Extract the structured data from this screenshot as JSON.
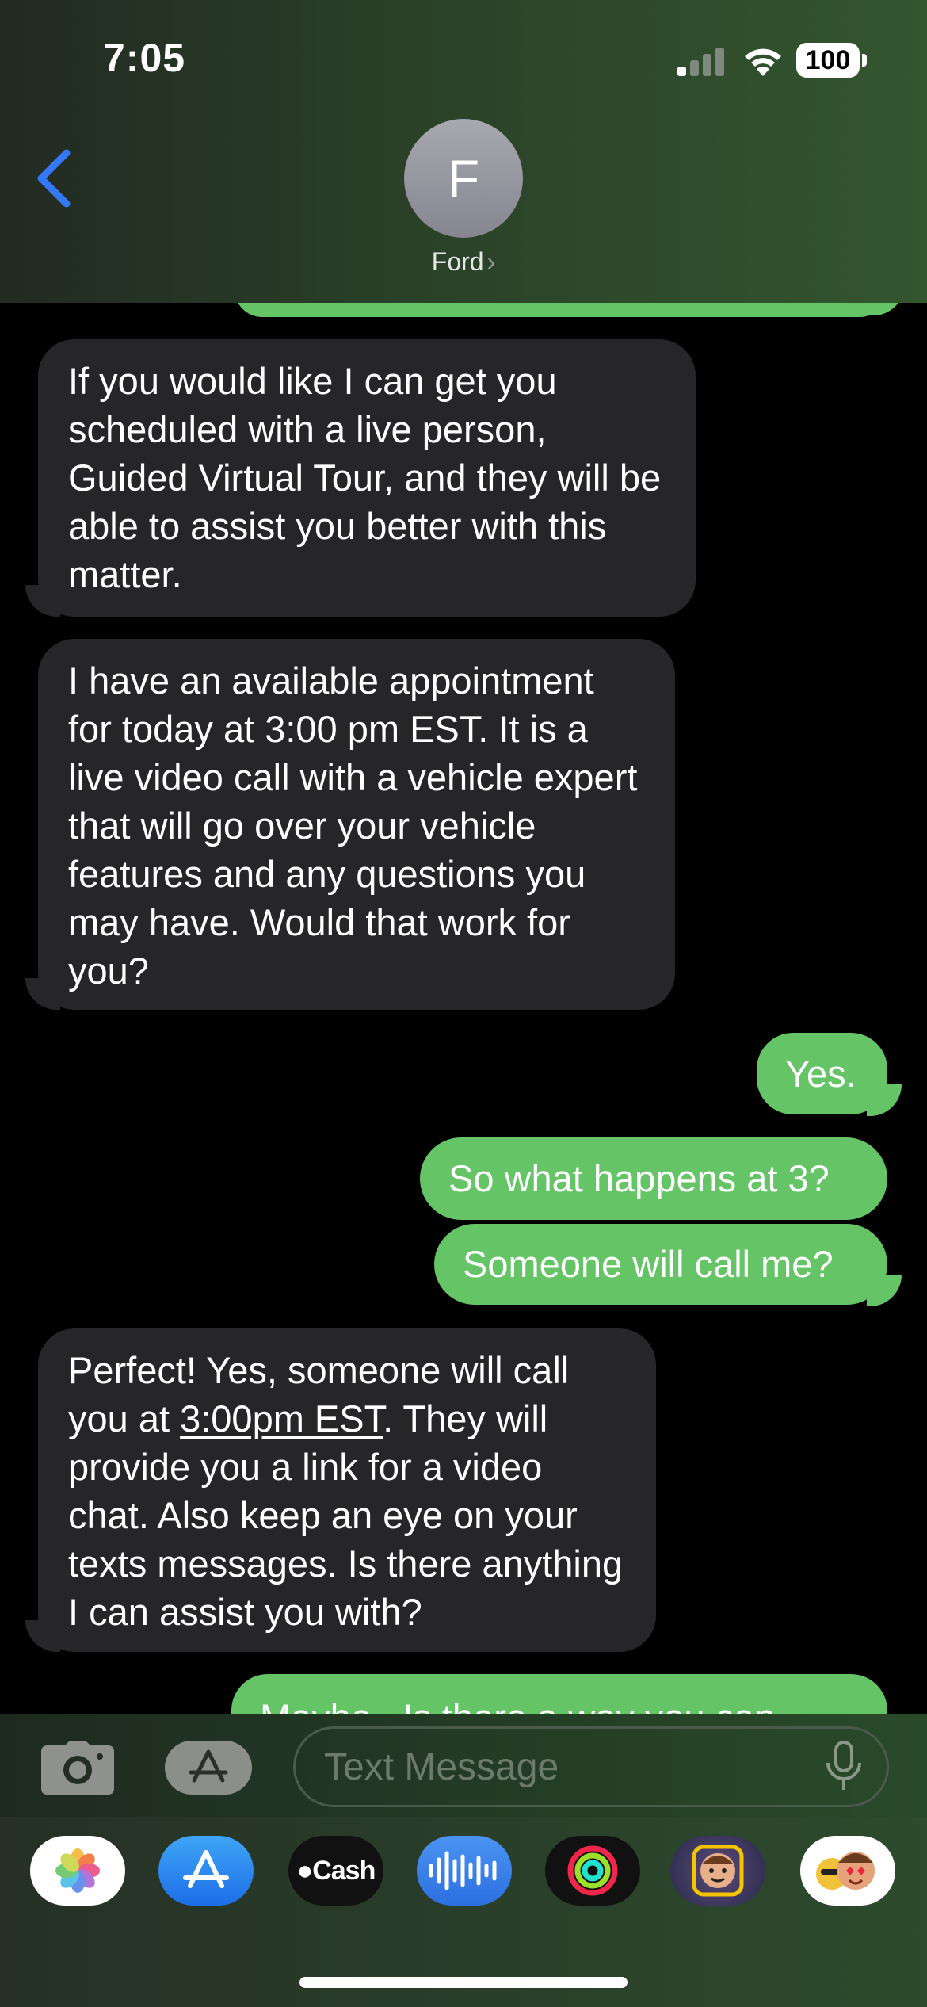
{
  "status_bar": {
    "time": "7:05",
    "battery": "100"
  },
  "header": {
    "avatar_letter": "F",
    "contact_name": "Ford",
    "chevron": "›"
  },
  "messages": [
    {
      "from": "them",
      "text": "If you would like I can get you scheduled with a live person, Guided Virtual Tour, and they will be able to assist you better with this matter."
    },
    {
      "from": "them",
      "text": "I have an available appointment for today at 3:00 pm EST. It is a live video call with a vehicle expert that will go over your vehicle features and any questions you may have. Would that work for you?"
    },
    {
      "from": "me",
      "text": "Yes."
    },
    {
      "from": "me",
      "text": "So what happens at 3?"
    },
    {
      "from": "me",
      "text": "Someone will call me?"
    },
    {
      "from": "them",
      "text_parts": [
        "Perfect! Yes, someone will call you at ",
        "3:00pm EST",
        ". They will provide you a link for a video chat. Also keep an eye on your texts messages. Is there anything I can assist you with?"
      ]
    },
    {
      "from": "me",
      "text": "Maybe...Is there a way you can"
    }
  ],
  "input": {
    "placeholder": "Text Message"
  },
  "apps": [
    {
      "name": "photos-app-icon"
    },
    {
      "name": "app-store-icon"
    },
    {
      "name": "apple-cash-icon",
      "label": "Cash"
    },
    {
      "name": "audio-message-icon"
    },
    {
      "name": "fitness-activity-icon"
    },
    {
      "name": "memoji-icon"
    },
    {
      "name": "memoji-stickers-icon"
    }
  ],
  "colors": {
    "incoming_bubble": "#262628",
    "outgoing_bubble": "#65c466",
    "ios_blue": "#3478f6"
  }
}
